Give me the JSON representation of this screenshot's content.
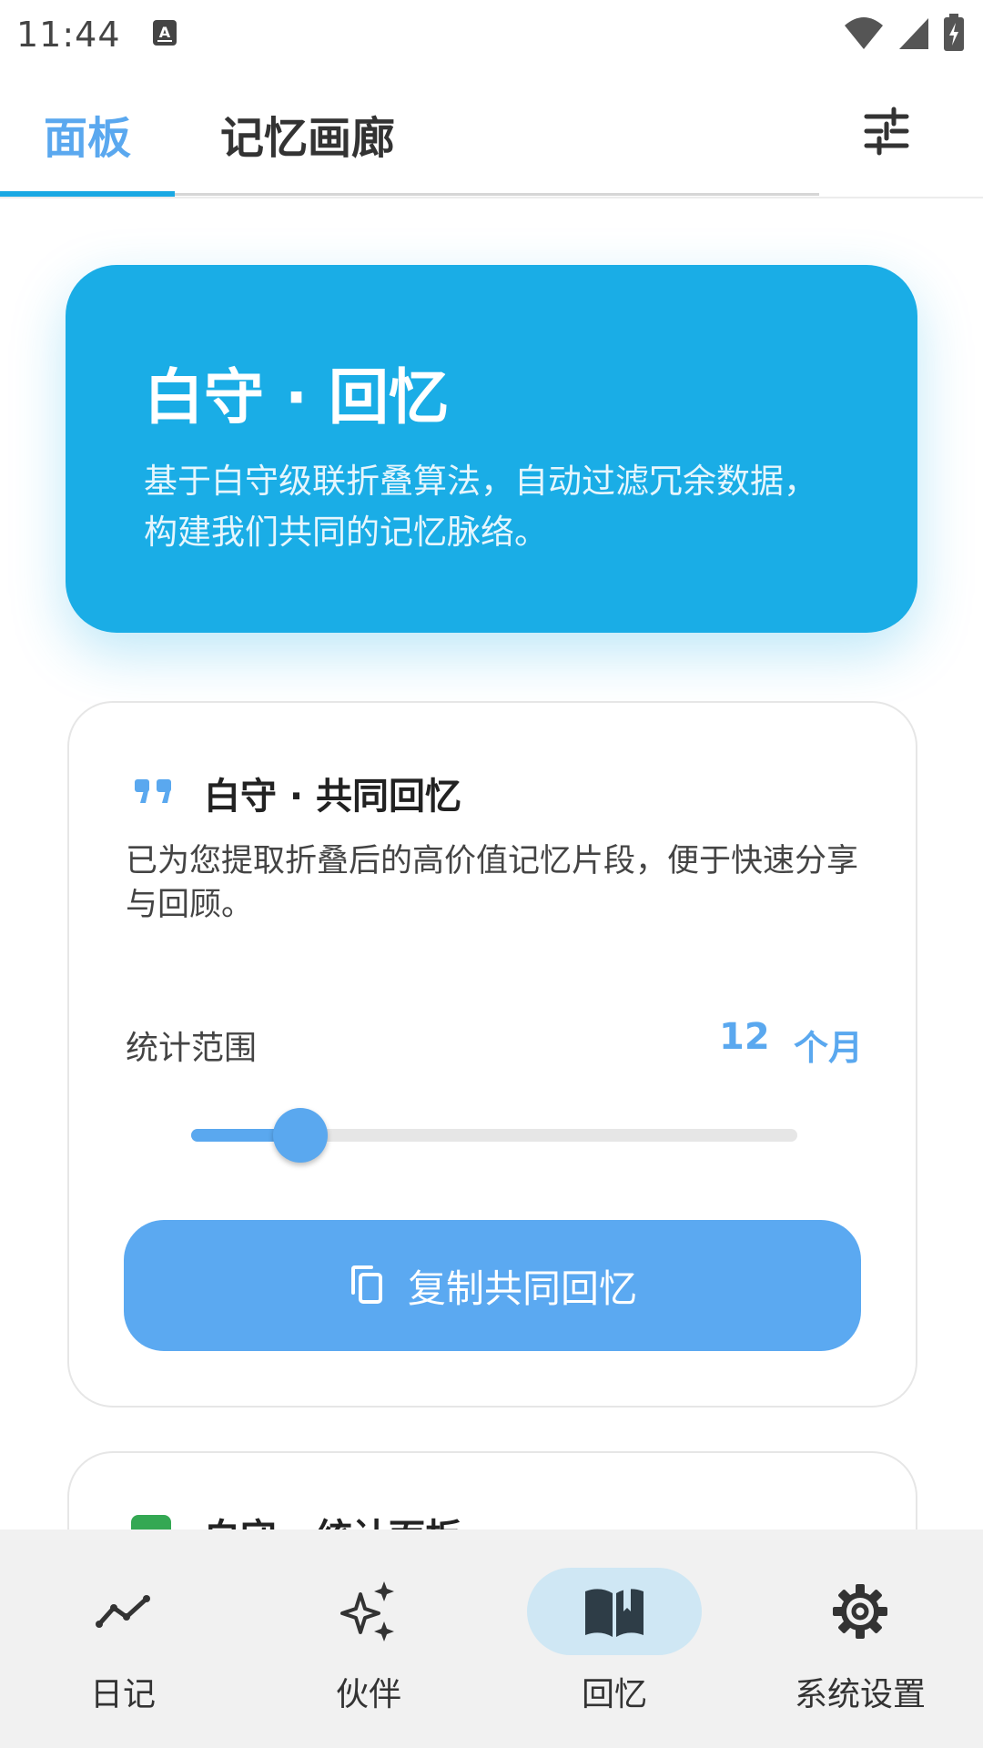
{
  "status_bar": {
    "time": "11:44"
  },
  "top_tabs": {
    "tabs": [
      {
        "label": "面板",
        "active": true
      },
      {
        "label": "记忆画廊",
        "active": false
      }
    ],
    "filter_icon": "tune-icon"
  },
  "hero": {
    "title": "白守 · 回忆",
    "description": "基于白守级联折叠算法，自动过滤冗余数据，构建我们共同的记忆脉络。",
    "background": "#1aade6"
  },
  "memory_card": {
    "icon": "quote-icon",
    "title": "白守 · 共同回忆",
    "description": "已为您提取折叠后的高价值记忆片段，便于快速分享与回顾。",
    "range_label": "统计范围",
    "range_value": "12",
    "range_unit": "个月",
    "slider_level": 0.18,
    "copy_button_label": "复制共同回忆",
    "copy_icon": "copy-icon",
    "accent": "#5aa8ef"
  },
  "next_card": {
    "title": "白守 · 统计面板",
    "icon": "chart-icon"
  },
  "bottom_nav": {
    "items": [
      {
        "label": "日记",
        "icon": "trend-line-icon",
        "active": false
      },
      {
        "label": "伙伴",
        "icon": "sparkle-icon",
        "active": false
      },
      {
        "label": "回忆",
        "icon": "book-icon",
        "active": true
      },
      {
        "label": "系统设置",
        "icon": "gear-icon",
        "active": false
      }
    ]
  }
}
